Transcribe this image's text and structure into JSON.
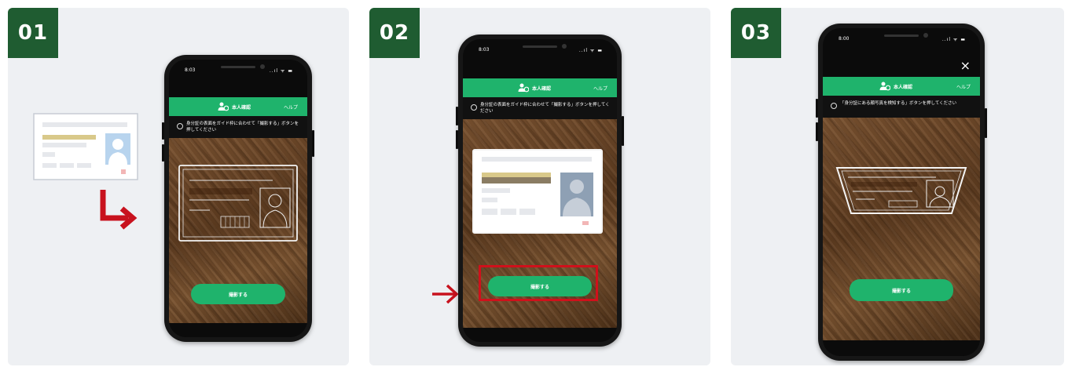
{
  "steps": [
    {
      "badge": "01",
      "phone": {
        "time": "8:03",
        "status_icons": "..ıl ᯤ ▬",
        "header_title": "本人確認",
        "header_help": "ヘルプ",
        "instruction": "身分証の表面をガイド枠に合わせて「撮影する」ボタンを押してください",
        "shoot_button": "撮影する"
      }
    },
    {
      "badge": "02",
      "phone": {
        "time": "8:03",
        "status_icons": "..ıl ᯤ ▬",
        "header_title": "本人確認",
        "header_help": "ヘルプ",
        "instruction": "身分証の表面をガイド枠に合わせて「撮影する」ボタンを押してください",
        "shoot_button": "撮影する"
      }
    },
    {
      "badge": "03",
      "phone": {
        "time": "8:00",
        "status_icons": "..ıl ᯤ ▬",
        "header_title": "本人確認",
        "header_help": "ヘルプ",
        "instruction": "「身分証にある顔写真を検知する」ボタンを押してください",
        "shoot_button": "撮影する",
        "close_icon": "×"
      }
    }
  ],
  "colors": {
    "badge_green": "#1f5c31",
    "header_green": "#1fb36c",
    "highlight_red": "#d0101b",
    "arrow_red": "#c8121e"
  }
}
